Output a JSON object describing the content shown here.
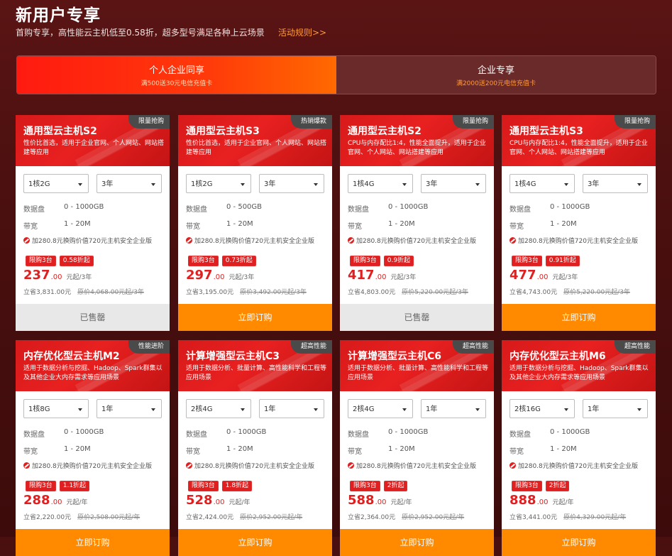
{
  "header": {
    "title": "新用户专享",
    "subtitle": "首购专享，高性能云主机低至0.58折，超多型号满足各种上云场景",
    "rules_link": "活动规则>>"
  },
  "tabs": [
    {
      "title": "个人企业同享",
      "sub": "满500送30元电信充值卡"
    },
    {
      "title": "企业专享",
      "sub": "满2000送200元电信充值卡"
    }
  ],
  "labels": {
    "disk": "数据盘",
    "bandwidth": "带宽",
    "promo": "加280.8元换购价值720元主机安全企业版",
    "limit": "限购3台",
    "save_prefix": "立省"
  },
  "cards": [
    {
      "badge": "限量抢购",
      "name": "通用型云主机S2",
      "desc": "性价比首选，适用于企业官网、个人网站、网站搭建等应用",
      "cpu": "1核2G",
      "term": "3年",
      "disk": "0 - 1000GB",
      "bw": "1 - 20M",
      "discount": "0.58折起",
      "price_int": "237",
      "price_dec": ".00",
      "unit": "元起/3年",
      "save": "立省3,831.00元",
      "orig": "原价4,068.00元起/3年",
      "button": "已售罄",
      "sold": true
    },
    {
      "badge": "热销爆款",
      "name": "通用型云主机S3",
      "desc": "性价比首选，适用于企业官网、个人网站、网站搭建等应用",
      "cpu": "1核2G",
      "term": "3年",
      "disk": "0 - 500GB",
      "bw": "1 - 20M",
      "discount": "0.73折起",
      "price_int": "297",
      "price_dec": ".00",
      "unit": "元起/3年",
      "save": "立省3,195.00元",
      "orig": "原价3,492.00元起/3年",
      "button": "立即订购",
      "sold": false
    },
    {
      "badge": "限量抢购",
      "name": "通用型云主机S2",
      "desc": "CPU与内存配比1:4，性能全面提升，适用于企业官网、个人网站、网站搭建等应用",
      "cpu": "1核4G",
      "term": "3年",
      "disk": "0 - 1000GB",
      "bw": "1 - 20M",
      "discount": "0.9折起",
      "price_int": "417",
      "price_dec": ".00",
      "unit": "元起/3年",
      "save": "立省4,803.00元",
      "orig": "原价5,220.00元起/3年",
      "button": "已售罄",
      "sold": true
    },
    {
      "badge": "限量抢购",
      "name": "通用型云主机S3",
      "desc": "CPU与内存配比1:4，性能全面提升，适用于企业官网、个人网站、网站搭建等应用",
      "cpu": "1核4G",
      "term": "3年",
      "disk": "0 - 1000GB",
      "bw": "1 - 20M",
      "discount": "0.91折起",
      "price_int": "477",
      "price_dec": ".00",
      "unit": "元起/3年",
      "save": "立省4,743.00元",
      "orig": "原价5,220.00元起/3年",
      "button": "立即订购",
      "sold": false
    },
    {
      "badge": "性能进阶",
      "name": "内存优化型云主机M2",
      "desc": "适用于数据分析与挖掘、Hadoop、Spark群集以及其他企业大内存需求等应用场景",
      "cpu": "1核8G",
      "term": "1年",
      "disk": "0 - 1000GB",
      "bw": "1 - 20M",
      "discount": "1.1折起",
      "price_int": "288",
      "price_dec": ".00",
      "unit": "元起/年",
      "save": "立省2,220.00元",
      "orig": "原价2,508.00元起/年",
      "button": "立即订购",
      "sold": false
    },
    {
      "badge": "超高性能",
      "name": "计算增强型云主机C3",
      "desc": "适用于数据分析、批量计算、高性能科学和工程等应用场景",
      "cpu": "2核4G",
      "term": "1年",
      "disk": "0 - 1000GB",
      "bw": "1 - 20M",
      "discount": "1.8折起",
      "price_int": "528",
      "price_dec": ".00",
      "unit": "元起/年",
      "save": "立省2,424.00元",
      "orig": "原价2,952.00元起/年",
      "button": "立即订购",
      "sold": false
    },
    {
      "badge": "超高性能",
      "name": "计算增强型云主机C6",
      "desc": "适用于数据分析、批量计算、高性能科学和工程等应用场景",
      "cpu": "2核4G",
      "term": "1年",
      "disk": "0 - 1000GB",
      "bw": "1 - 20M",
      "discount": "2折起",
      "price_int": "588",
      "price_dec": ".00",
      "unit": "元起/年",
      "save": "立省2,364.00元",
      "orig": "原价2,952.00元起/年",
      "button": "立即订购",
      "sold": false
    },
    {
      "badge": "超高性能",
      "name": "内存优化型云主机M6",
      "desc": "适用于数据分析与挖掘、Hadoop、Spark群集以及其他企业大内存需求等应用场景",
      "cpu": "2核16G",
      "term": "1年",
      "disk": "0 - 1000GB",
      "bw": "1 - 20M",
      "discount": "2折起",
      "price_int": "888",
      "price_dec": ".00",
      "unit": "元起/年",
      "save": "立省3,441.00元",
      "orig": "原价4,329.00元起/年",
      "button": "立即订购",
      "sold": false
    }
  ]
}
